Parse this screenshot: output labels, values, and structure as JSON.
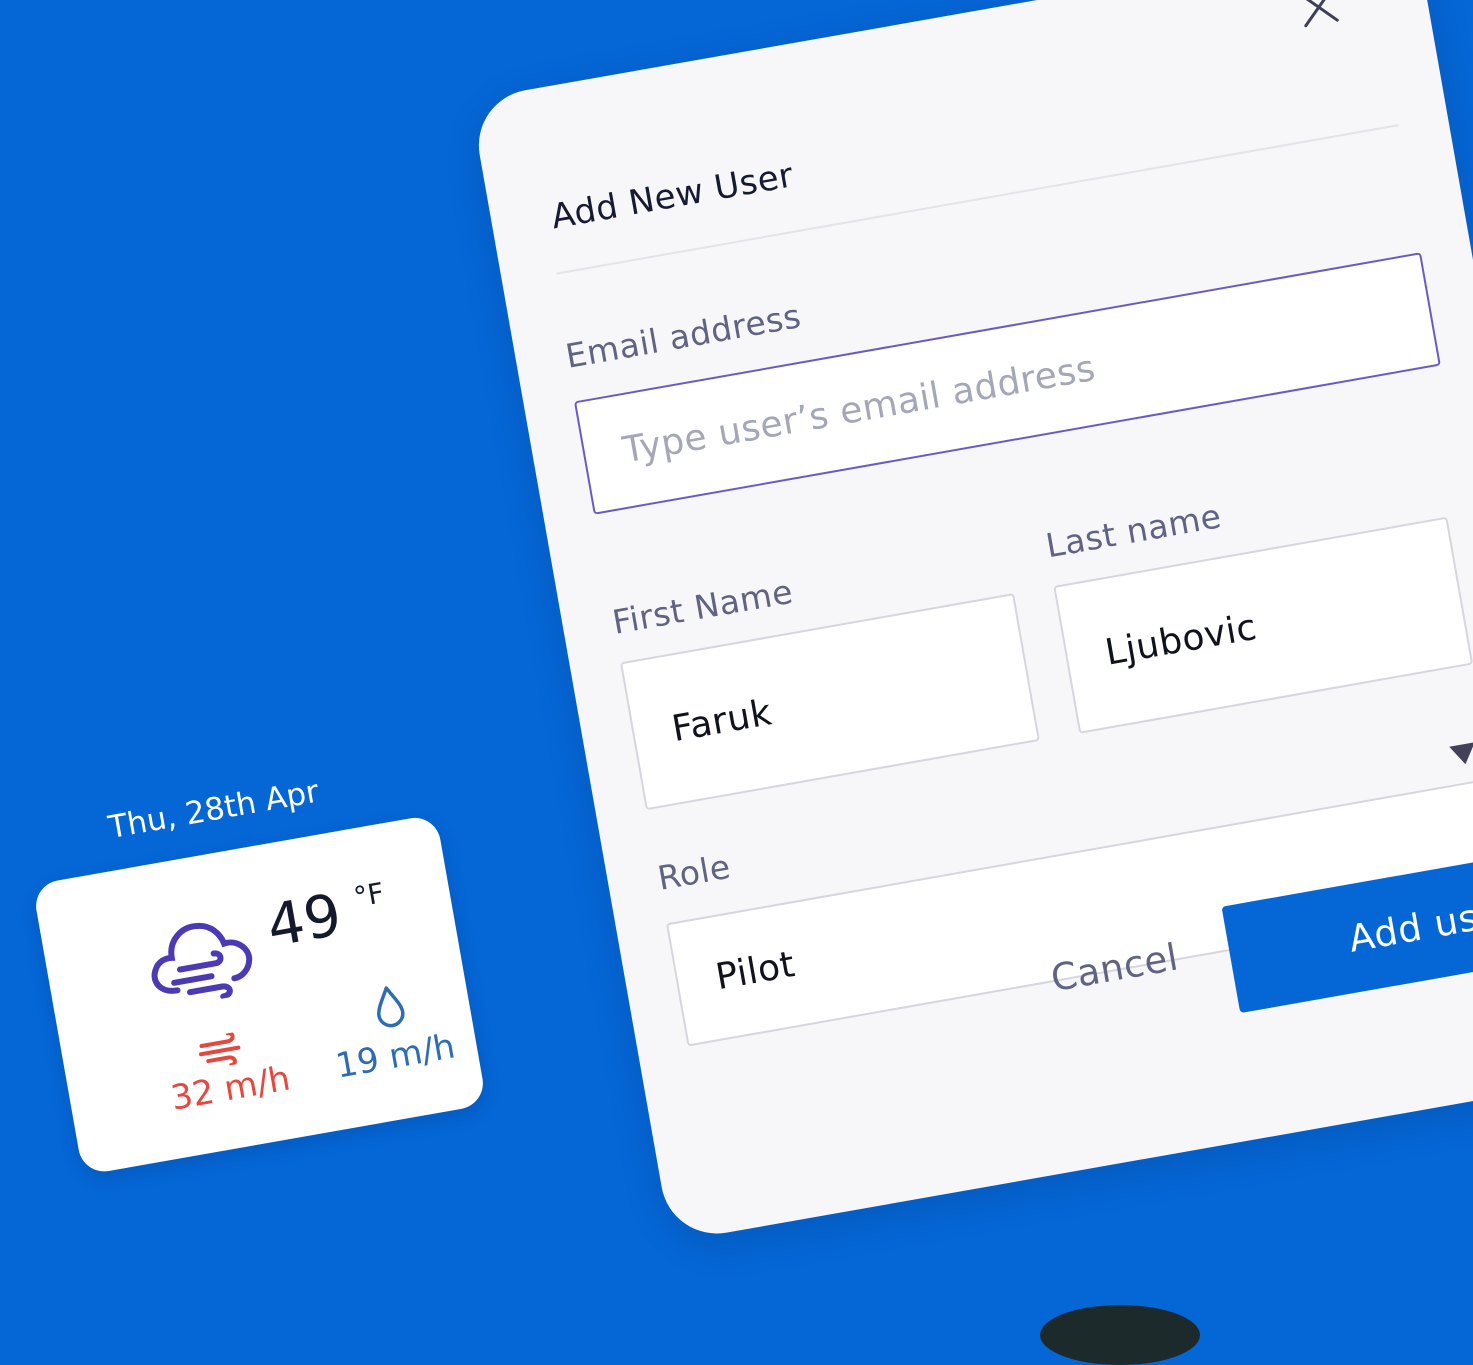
{
  "dialog": {
    "title": "Add New User",
    "email": {
      "label": "Email address",
      "placeholder": "Type user’s email address"
    },
    "first_name": {
      "label": "First Name",
      "value": "Faruk"
    },
    "last_name": {
      "label": "Last name",
      "value": "Ljubovic"
    },
    "role": {
      "label": "Role",
      "value": "Pilot"
    },
    "cancel_label": "Cancel",
    "submit_label": "Add user"
  },
  "weather": {
    "date": "Thu, 28th Apr",
    "temperature": "49",
    "unit": "°F",
    "wind": "32 m/h",
    "humidity": "19 m/h",
    "icons": [
      "cloud-wind-icon",
      "wind-icon",
      "droplet-icon",
      "close-icon",
      "caret-down-icon"
    ]
  },
  "colors": {
    "background": "#0566D6",
    "accent": "#0566D6",
    "focus_border": "#6a5bc4",
    "wind": "#E5483E",
    "humidity": "#2E6DB4",
    "cloud": "#4A3AB5"
  }
}
